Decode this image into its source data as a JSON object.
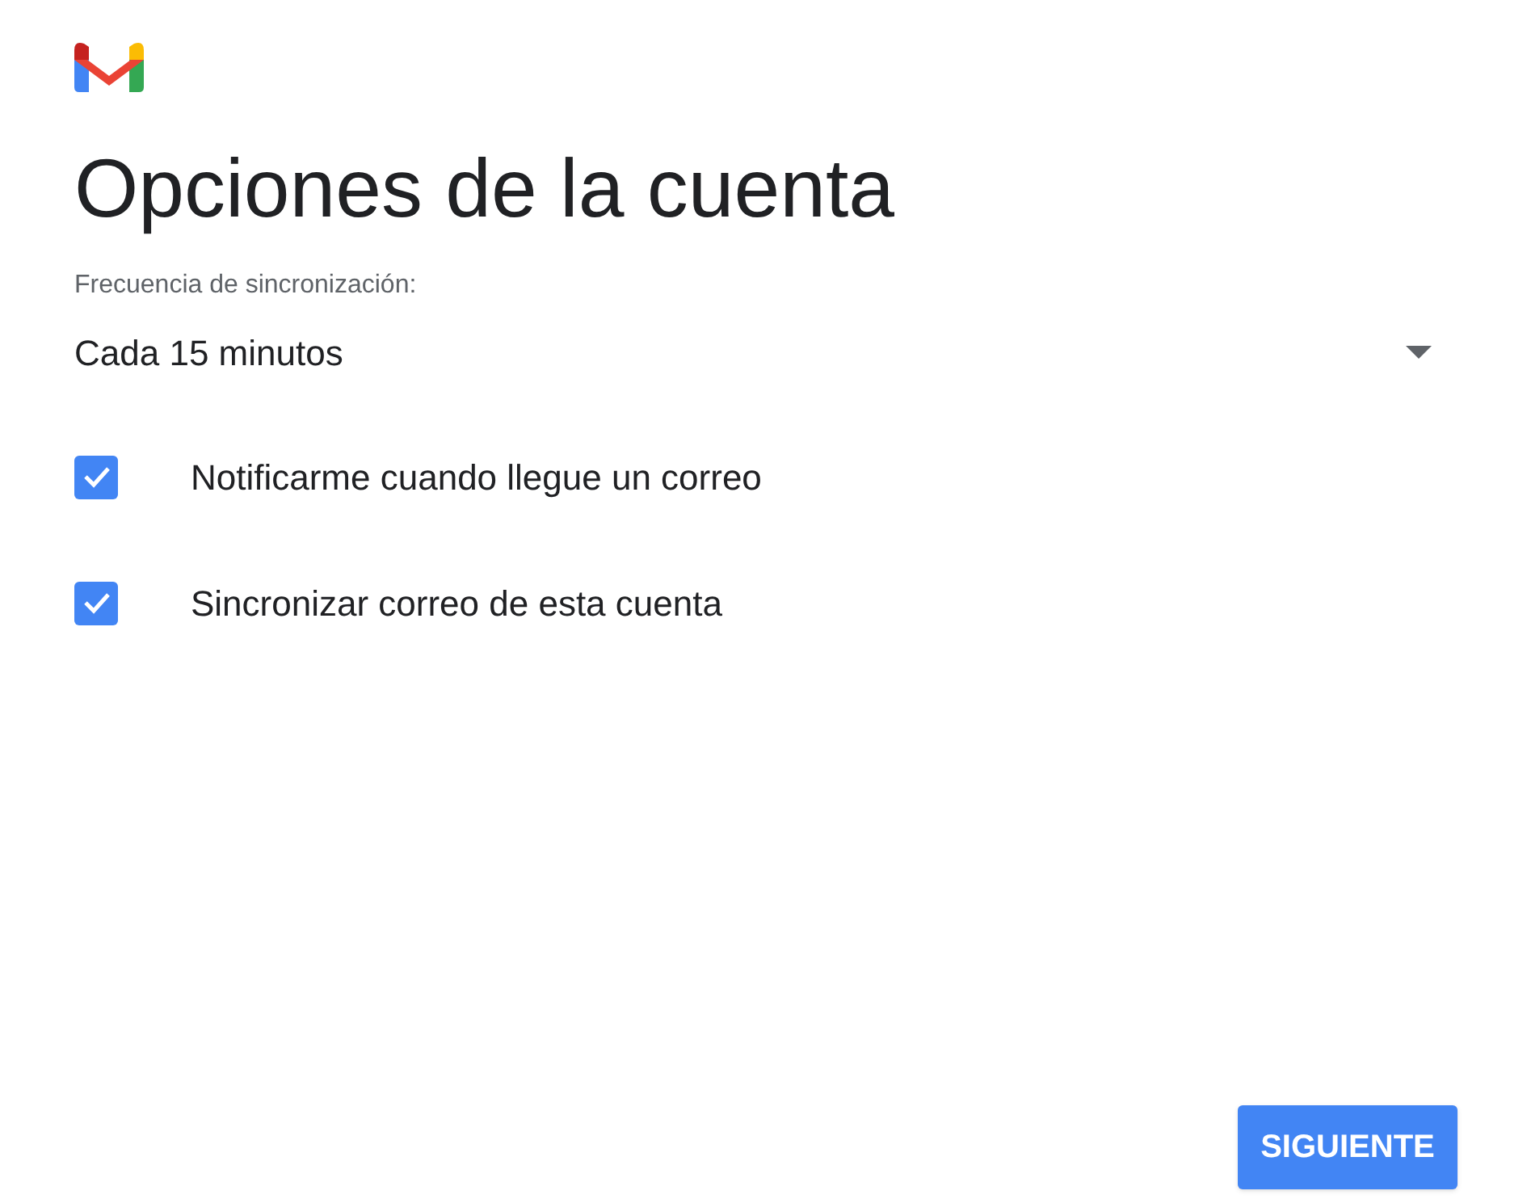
{
  "title": "Opciones de la cuenta",
  "sync_frequency": {
    "label": "Frecuencia de sincronización:",
    "value": "Cada 15 minutos"
  },
  "options": [
    {
      "label": "Notificarme cuando llegue un correo",
      "checked": true
    },
    {
      "label": "Sincronizar correo de esta cuenta",
      "checked": true
    }
  ],
  "next_button": "SIGUIENTE"
}
